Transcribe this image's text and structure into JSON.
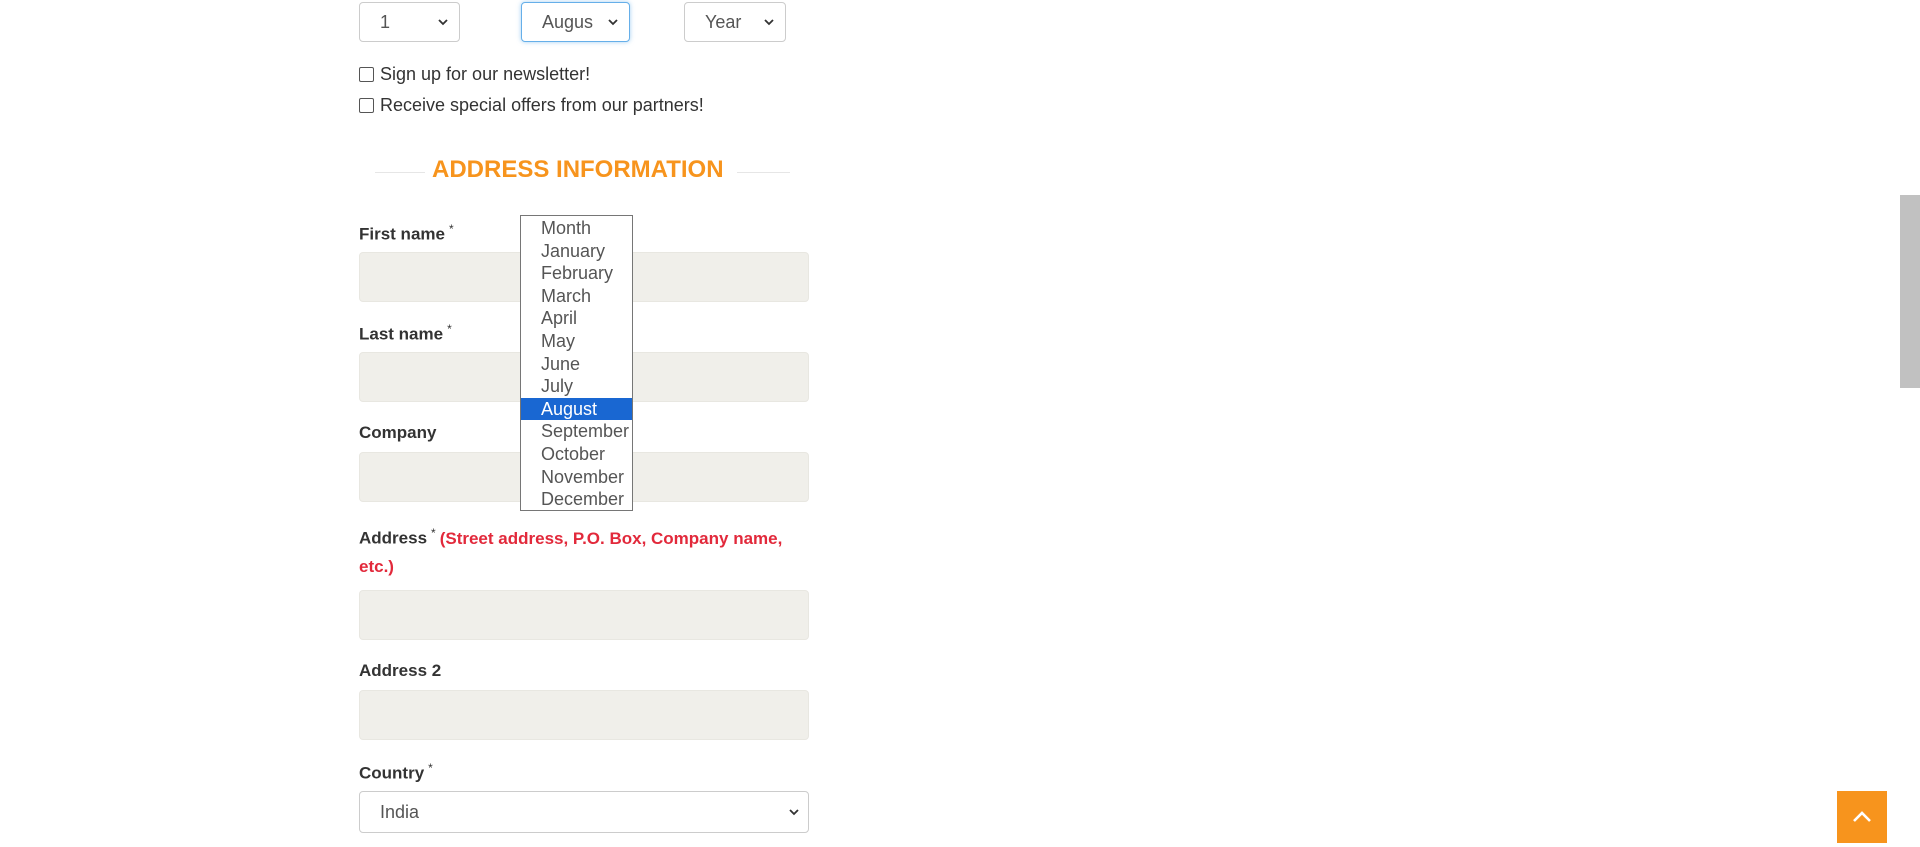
{
  "dob": {
    "day_value": "1",
    "month_value": "Augus",
    "year_value": "Year"
  },
  "checkboxes": {
    "newsletter_label": "Sign up for our newsletter!",
    "offers_label": "Receive special offers from our partners!"
  },
  "section": {
    "title": "ADDRESS INFORMATION"
  },
  "fields": {
    "first_name": "First name",
    "last_name": "Last name",
    "company": "Company",
    "address": "Address",
    "address_hint": "(Street address, P.O. Box, Company name,",
    "address_hint_cont": "etc.)",
    "address2": "Address 2",
    "country": "Country",
    "required_mark": "*"
  },
  "country_select": {
    "value": "India"
  },
  "month_dropdown": {
    "options": [
      "Month",
      "January",
      "February",
      "March",
      "April",
      "May",
      "June",
      "July",
      "August",
      "September",
      "October",
      "November",
      "December"
    ],
    "selected": "August"
  },
  "colors": {
    "accent": "#f7941d",
    "hint_red": "#e2293b",
    "selected_option": "#1967d2",
    "input_bg": "#f0efea"
  },
  "icons": {
    "select_arrow": "chevron-down-icon",
    "back_to_top": "chevron-up-icon"
  }
}
